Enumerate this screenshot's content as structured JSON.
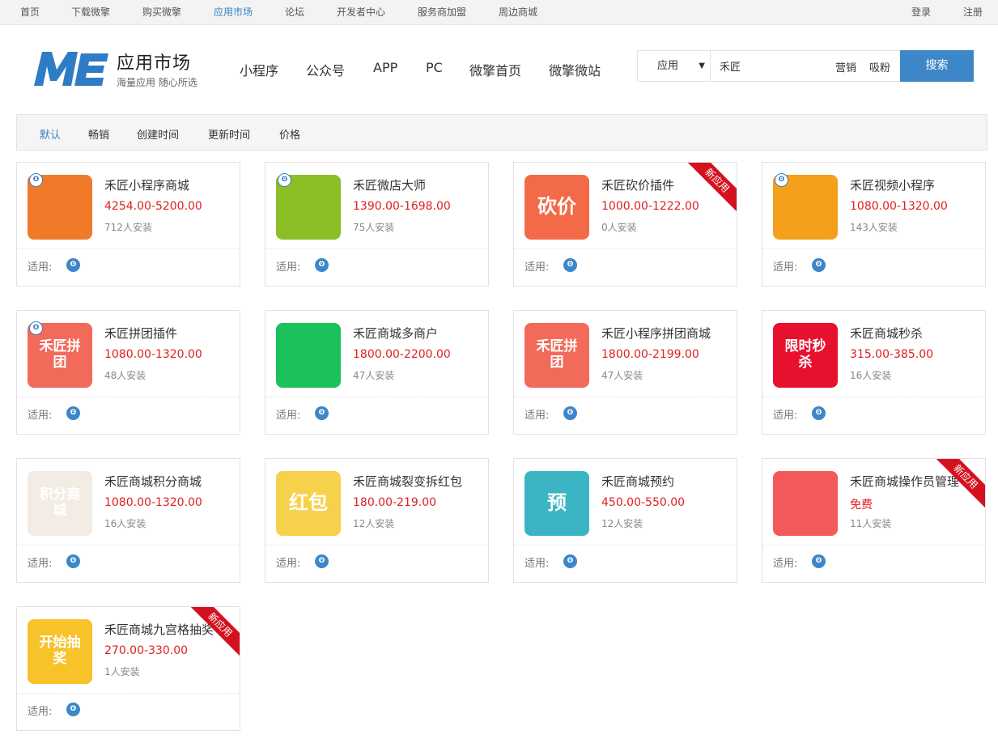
{
  "topbar": {
    "left": [
      "首页",
      "下载微擎",
      "购买微擎",
      "应用市场",
      "论坛",
      "开发者中心",
      "服务商加盟",
      "周边商城"
    ],
    "active_index": 3,
    "login": "登录",
    "register": "注册"
  },
  "brand": {
    "title": "应用市场",
    "subtitle": "海量应用 随心所选"
  },
  "mainnav": [
    "小程序",
    "公众号",
    "APP",
    "PC",
    "微擎首页",
    "微擎微站"
  ],
  "search": {
    "type_value": "应用",
    "query": "禾匠",
    "hot_words": [
      "营销",
      "吸粉"
    ],
    "button": "搜索"
  },
  "sort": {
    "items": [
      "默认",
      "畅销",
      "创建时间",
      "更新时间",
      "价格"
    ],
    "active_index": 0
  },
  "fit_label": "适用:",
  "new_ribbon": "新应用",
  "products": [
    {
      "name": "禾匠小程序商城",
      "price": "4254.00-5200.00",
      "installs": "712人安装",
      "badge": true,
      "new": false,
      "icon_color": "#f07a2a",
      "icon_text": ""
    },
    {
      "name": "禾匠微店大师",
      "price": "1390.00-1698.00",
      "installs": "75人安装",
      "badge": true,
      "new": false,
      "icon_color": "#8cbf26",
      "icon_text": ""
    },
    {
      "name": "禾匠砍价插件",
      "price": "1000.00-1222.00",
      "installs": "0人安装",
      "badge": false,
      "new": true,
      "icon_color": "#f26a48",
      "icon_text": "砍价"
    },
    {
      "name": "禾匠视频小程序",
      "price": "1080.00-1320.00",
      "installs": "143人安装",
      "badge": true,
      "new": false,
      "icon_color": "#f4a01a",
      "icon_text": ""
    },
    {
      "name": "禾匠拼团插件",
      "price": "1080.00-1320.00",
      "installs": "48人安装",
      "badge": true,
      "new": false,
      "icon_color": "#f26a5a",
      "icon_text": "禾匠拼团"
    },
    {
      "name": "禾匠商城多商户",
      "price": "1800.00-2200.00",
      "installs": "47人安装",
      "badge": false,
      "new": false,
      "icon_color": "#1bc15a",
      "icon_text": ""
    },
    {
      "name": "禾匠小程序拼团商城",
      "price": "1800.00-2199.00",
      "installs": "47人安装",
      "badge": false,
      "new": false,
      "icon_color": "#f26a5a",
      "icon_text": "禾匠拼团"
    },
    {
      "name": "禾匠商城秒杀",
      "price": "315.00-385.00",
      "installs": "16人安装",
      "badge": false,
      "new": false,
      "icon_color": "#e8112d",
      "icon_text": "限时秒杀"
    },
    {
      "name": "禾匠商城积分商城",
      "price": "1080.00-1320.00",
      "installs": "16人安装",
      "badge": false,
      "new": false,
      "icon_color": "#f2ece4",
      "icon_text": "积分商城"
    },
    {
      "name": "禾匠商城裂变拆红包",
      "price": "180.00-219.00",
      "installs": "12人安装",
      "badge": false,
      "new": false,
      "icon_color": "#f6d24c",
      "icon_text": "红包"
    },
    {
      "name": "禾匠商城预约",
      "price": "450.00-550.00",
      "installs": "12人安装",
      "badge": false,
      "new": false,
      "icon_color": "#3bb5c4",
      "icon_text": "预"
    },
    {
      "name": "禾匠商城操作员管理",
      "price": "免费",
      "installs": "11人安装",
      "badge": false,
      "new": true,
      "icon_color": "#f25a5a",
      "icon_text": ""
    },
    {
      "name": "禾匠商城九宫格抽奖",
      "price": "270.00-330.00",
      "installs": "1人安装",
      "badge": false,
      "new": true,
      "icon_color": "#f7c22a",
      "icon_text": "开始抽奖"
    }
  ]
}
